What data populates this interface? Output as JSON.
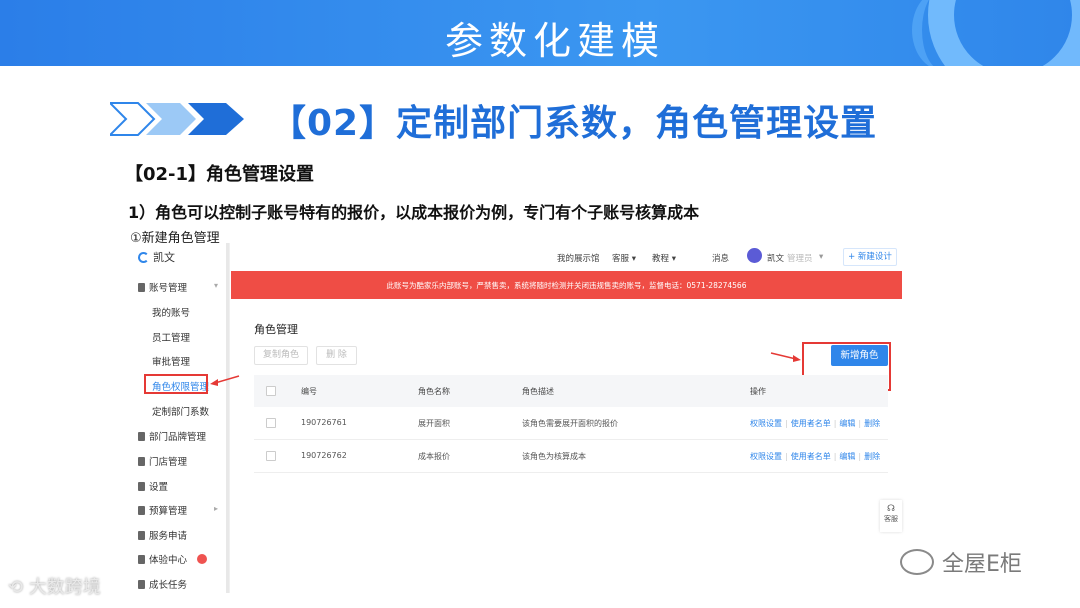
{
  "banner": {
    "title": "参数化建模"
  },
  "heading": {
    "title": "【02】定制部门系数，角色管理设置"
  },
  "section": {
    "subtitle": "【02-1】角色管理设置"
  },
  "description": {
    "text": "1）角色可以控制子账号特有的报价，以成本报价为例，专门有个子账号核算成本"
  },
  "step": {
    "label": "①新建角色管理"
  },
  "app": {
    "logo_text": "凯文",
    "sidebar": {
      "account_mgmt": "账号管理",
      "sub_items": [
        "我的账号",
        "员工管理",
        "审批管理",
        "角色权限管理",
        "定制部门系数"
      ],
      "items": [
        "部门品牌管理",
        "门店管理",
        "设置",
        "预算管理",
        "服务申请",
        "体验中心",
        "成长任务"
      ]
    },
    "topbar": {
      "showroom": "我的展示馆",
      "service": "客服",
      "tutorial": "教程",
      "messages": "消息",
      "user_name": "凯文",
      "user_role": "管理员",
      "new_design": "+ 新建设计"
    },
    "notice": "此账号为酷家乐内部账号，严禁售卖，系统将随时检测并关闭违规售卖的账号，监督电话：0571-28274566",
    "page_title": "角色管理",
    "buttons": {
      "copy_role": "复制角色",
      "delete": "删 除",
      "new_role": "新增角色"
    },
    "table": {
      "headers": [
        "编号",
        "角色名称",
        "角色描述",
        "操作"
      ],
      "rows": [
        {
          "id": "190726761",
          "name": "展开面积",
          "desc": "该角色需要展开面积的报价"
        },
        {
          "id": "190726762",
          "name": "成本报价",
          "desc": "该角色为核算成本"
        }
      ],
      "ops": [
        "权限设置",
        "使用者名单",
        "编辑",
        "删除"
      ]
    },
    "float_service": "客服"
  },
  "watermarks": {
    "left": "大数跨境",
    "right": "全屋E柜"
  },
  "colors": {
    "banner": "#2f86ea",
    "heading": "#1f6ed8",
    "notice": "#ef4d45",
    "primary": "#2f86ea",
    "highlight": "#e53935"
  }
}
